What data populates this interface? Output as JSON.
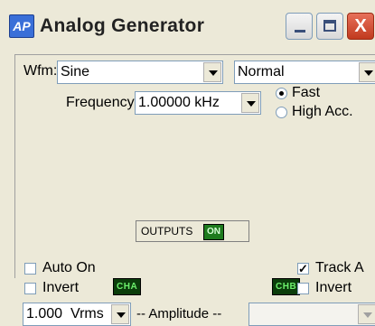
{
  "window": {
    "icon_text": "AP",
    "title": "Analog Generator",
    "buttons": {
      "minimize": "",
      "maximize": "",
      "close": "X"
    }
  },
  "waveform": {
    "label": "Wfm:",
    "value": "Sine",
    "mode_value": "Normal"
  },
  "frequency": {
    "label": "Frequency:",
    "value": "1.00000 kHz",
    "options": [
      {
        "label": "Fast",
        "selected": true
      },
      {
        "label": "High Acc.",
        "selected": false
      }
    ]
  },
  "controls": {
    "auto_on": {
      "label": "Auto On",
      "checked": false
    },
    "invent_a": {
      "label": "Invert",
      "checked": false
    },
    "track_a": {
      "label": "Track A",
      "checked": true
    },
    "invert_b": {
      "label": "Invert",
      "checked": false
    },
    "cha_badge": "CHA",
    "chb_badge": "CHB",
    "outputs_label": "OUTPUTS",
    "outputs_state": "ON"
  },
  "amplitude": {
    "value": "1.000",
    "unit": "Vrms",
    "label": "-- Amplitude --"
  },
  "colors": {
    "face": "#ece9d8",
    "close_button": "#c13a1f",
    "channel_badge_bg": "#0b3d0b",
    "channel_badge_text": "#6cf06c",
    "on_badge": "#1e7a1e"
  }
}
